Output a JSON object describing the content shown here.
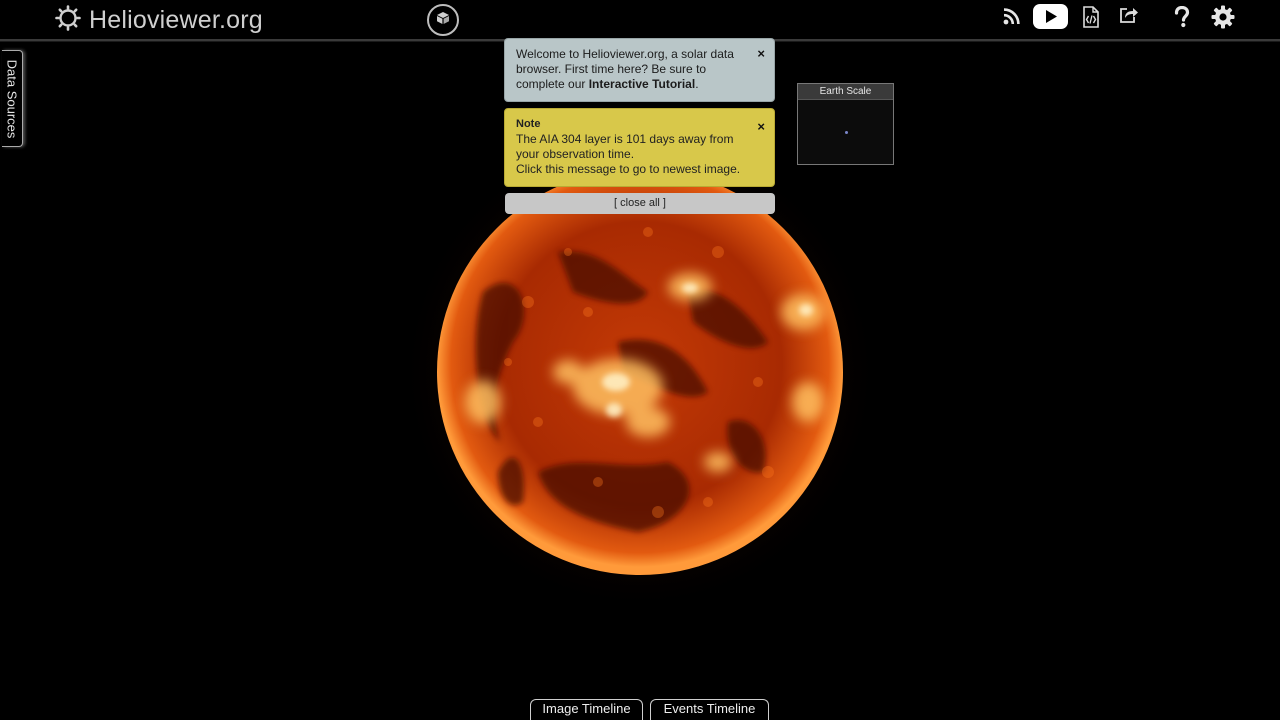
{
  "app": {
    "title": "Helioviewer.org"
  },
  "header": {
    "icons": [
      {
        "name": "rss-icon"
      },
      {
        "name": "youtube-icon"
      },
      {
        "name": "code-file-icon"
      },
      {
        "name": "share-icon"
      },
      {
        "name": "help-icon"
      },
      {
        "name": "settings-icon"
      }
    ]
  },
  "sidebar": {
    "data_sources_label": "Data Sources"
  },
  "notifications": {
    "welcome": {
      "text_before": "Welcome to Helioviewer.org, a solar data browser. First time here? Be sure to complete our ",
      "link": "Interactive Tutorial",
      "text_after": ".",
      "close": "×"
    },
    "note": {
      "title": "Note",
      "line1": "The AIA 304 layer is 101 days away from your observation time.",
      "line2": "Click this message to go to newest image.",
      "close": "×"
    },
    "close_all": "[ close all ]"
  },
  "earth_scale": {
    "title": "Earth Scale"
  },
  "timelines": {
    "image": "Image Timeline",
    "events": "Events Timeline"
  },
  "colors": {
    "sun_core": "#c43a06",
    "sun_bright": "#ffd27a",
    "welcome_bg": "#b9c6c8",
    "note_bg": "#d8c84a"
  }
}
